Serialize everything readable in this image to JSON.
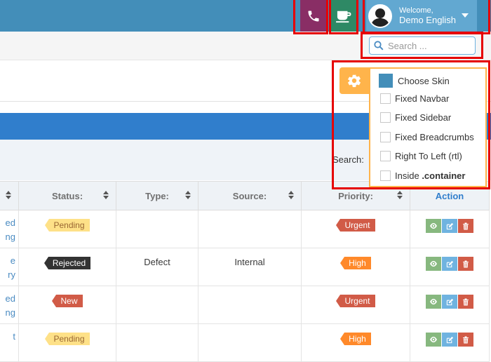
{
  "navbar": {
    "welcome_label": "Welcome,",
    "user_name": "Demo English",
    "phone_icon": "phone-icon",
    "coffee_icon": "coffee-icon",
    "colors": {
      "navbar": "#438eb9",
      "phone": "#892e65",
      "coffee": "#2e8965",
      "user": "#62a8d1"
    }
  },
  "search": {
    "placeholder": "Search ..."
  },
  "settings": {
    "options": [
      {
        "label": "Choose Skin",
        "type": "skin"
      },
      {
        "label": "Fixed Navbar",
        "type": "checkbox"
      },
      {
        "label": "Fixed Sidebar",
        "type": "checkbox"
      },
      {
        "label": "Fixed Breadcrumbs",
        "type": "checkbox"
      },
      {
        "label": "Right To Left (rtl)",
        "type": "checkbox"
      },
      {
        "label_prefix": "Inside ",
        "label_bold": ".container",
        "type": "checkbox"
      }
    ]
  },
  "table_tools": {
    "search_label": "Search:"
  },
  "table": {
    "headers": [
      "Status:",
      "Type:",
      "Source:",
      "Priority:",
      "Action"
    ],
    "rows": [
      {
        "link": [
          "ed",
          "ng"
        ],
        "status": "Pending",
        "type": "",
        "source": "",
        "priority": "Urgent"
      },
      {
        "link": [
          "e",
          "ry"
        ],
        "status": "Rejected",
        "type": "Defect",
        "source": "Internal",
        "priority": "High"
      },
      {
        "link": [
          "ed",
          "ng"
        ],
        "status": "New",
        "type": "",
        "source": "",
        "priority": "Urgent"
      },
      {
        "link": [
          "t"
        ],
        "status": "Pending",
        "type": "",
        "source": "",
        "priority": "High"
      }
    ]
  }
}
